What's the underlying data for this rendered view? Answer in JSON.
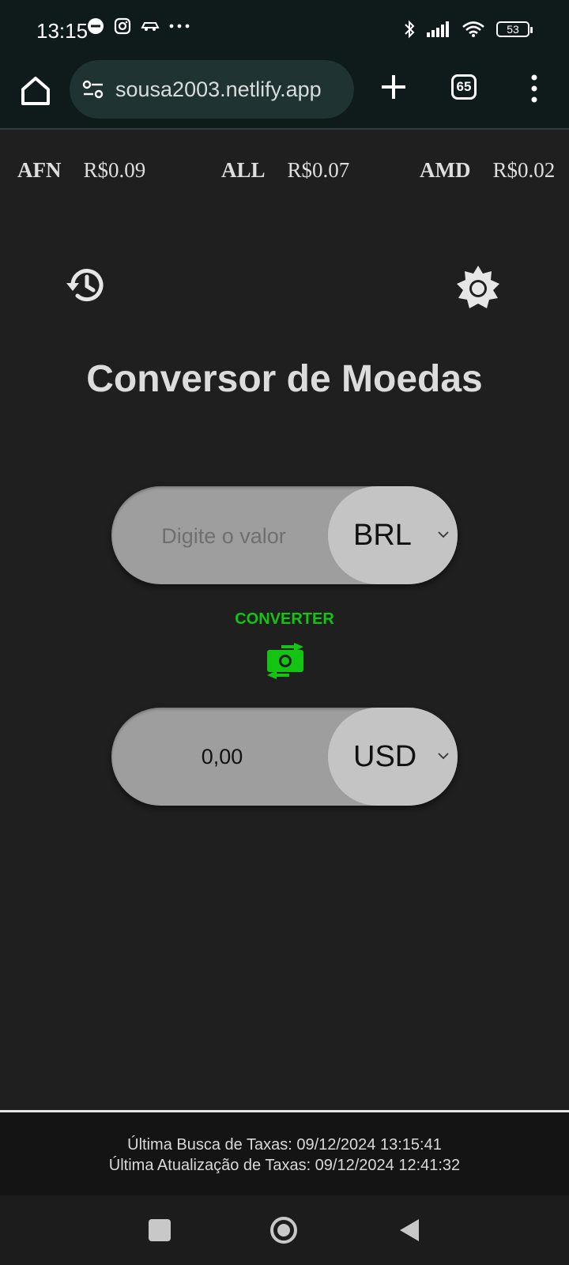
{
  "status_bar": {
    "time": "13:15",
    "battery": "53",
    "left_icons": [
      "e-app-icon",
      "instagram-icon",
      "car-icon",
      "more-dots-icon"
    ],
    "right_icons": [
      "bluetooth-icon",
      "signal-icon",
      "wifi-icon",
      "battery-icon"
    ]
  },
  "browser": {
    "url": "sousa2003.netlify.app",
    "tabs_count": "65"
  },
  "ticker": [
    {
      "code": "AFN",
      "value": "R$0.09"
    },
    {
      "code": "ALL",
      "value": "R$0.07"
    },
    {
      "code": "AMD",
      "value": "R$0.02"
    }
  ],
  "app": {
    "title": "Conversor de Moedas",
    "from": {
      "placeholder": "Digite o valor",
      "currency": "BRL"
    },
    "convert_label": "CONVERTER",
    "to": {
      "value": "0,00",
      "currency": "USD"
    },
    "accent_color": "#13c413"
  },
  "footer": {
    "last_fetch": "Última Busca de Taxas: 09/12/2024 13:15:41",
    "last_update": "Última Atualização de Taxas: 09/12/2024 12:41:32"
  }
}
